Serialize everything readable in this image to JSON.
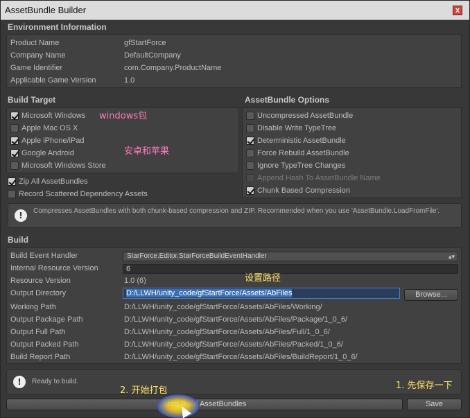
{
  "window": {
    "title": "AssetBundle Builder",
    "close_glyph": "x"
  },
  "environment": {
    "header": "Environment Information",
    "rows": [
      {
        "label": "Product Name",
        "value": "gfStartForce"
      },
      {
        "label": "Company Name",
        "value": "DefaultCompany"
      },
      {
        "label": "Game Identifier",
        "value": "com.Company.ProductName"
      },
      {
        "label": "Applicable Game Version",
        "value": "1.0"
      }
    ]
  },
  "build_target": {
    "header": "Build Target",
    "platforms": [
      {
        "label": "Microsoft Windows",
        "checked": true
      },
      {
        "label": "Apple Mac OS X",
        "checked": false
      },
      {
        "label": "Apple iPhone/iPad",
        "checked": true
      },
      {
        "label": "Google Android",
        "checked": true
      },
      {
        "label": "Microsoft Windows Store",
        "checked": false
      }
    ],
    "zip_label": "Zip All AssetBundles",
    "zip_checked": true,
    "record_label": "Record Scattered Dependency Assets",
    "record_checked": false
  },
  "assetbundle_options": {
    "header": "AssetBundle Options",
    "options": [
      {
        "label": "Uncompressed AssetBundle",
        "checked": false,
        "disabled": false
      },
      {
        "label": "Disable Write TypeTree",
        "checked": false,
        "disabled": false
      },
      {
        "label": "Deterministic AssetBundle",
        "checked": true,
        "disabled": false
      },
      {
        "label": "Force Rebuild AssetBundle",
        "checked": false,
        "disabled": false
      },
      {
        "label": "Ignore TypeTree Changes",
        "checked": false,
        "disabled": false
      },
      {
        "label": "Append Hash To AssetBundle Name",
        "checked": false,
        "disabled": true
      },
      {
        "label": "Chunk Based Compression",
        "checked": true,
        "disabled": false
      }
    ]
  },
  "info": {
    "icon": "info-icon",
    "text": "Compresses AssetBundles with both chunk-based compression and ZIP. Recommended when you use 'AssetBundle.LoadFromFile'."
  },
  "build": {
    "header": "Build",
    "event_handler_label": "Build Event Handler",
    "event_handler_value": "StarForce.Editor.StarForceBuildEventHandler",
    "internal_version_label": "Internal Resource Version",
    "internal_version_value": "6",
    "resource_version_label": "Resource Version",
    "resource_version_value": "1.0 (6)",
    "output_dir_label": "Output Directory",
    "output_dir_value": "D:/LLWH/unity_code/gfStartForce/Assets/AbFiles",
    "browse_label": "Browse...",
    "paths": [
      {
        "label": "Working Path",
        "value": "D:/LLWH/unity_code/gfStartForce/Assets/AbFiles/Working/"
      },
      {
        "label": "Output Package Path",
        "value": "D:/LLWH/unity_code/gfStartForce/Assets/AbFiles/Package/1_0_6/"
      },
      {
        "label": "Output Full Path",
        "value": "D:/LLWH/unity_code/gfStartForce/Assets/AbFiles/Full/1_0_6/"
      },
      {
        "label": "Output Packed Path",
        "value": "D:/LLWH/unity_code/gfStartForce/Assets/AbFiles/Packed/1_0_6/"
      },
      {
        "label": "Build Report Path",
        "value": "D:/LLWH/unity_code/gfStartForce/Assets/AbFiles/BuildReport/1_0_6/"
      }
    ]
  },
  "status": {
    "text": "Ready to build."
  },
  "buttons": {
    "start_build": "Start Build AssetBundles",
    "save": "Save"
  },
  "annotations": {
    "windows": "windows包",
    "android_apple": "安卓和苹果",
    "set_path": "设置路径",
    "start_pack": "2. 开始打包",
    "save_first": "1. 先保存一下"
  },
  "colors": {
    "annotation_yellow": "#ffe066",
    "annotation_pink": "#ff7ac0",
    "selection_blue": "#3a6fb5"
  }
}
